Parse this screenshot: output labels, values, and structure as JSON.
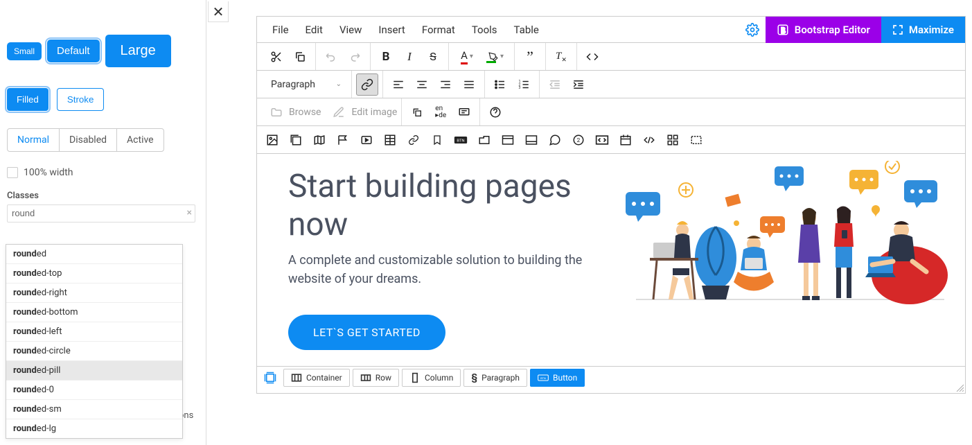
{
  "sidebar": {
    "sizes": {
      "small": "Small",
      "default": "Default",
      "large": "Large"
    },
    "fill": {
      "filled": "Filled",
      "stroke": "Stroke"
    },
    "states": {
      "normal": "Normal",
      "disabled": "Disabled",
      "active": "Active"
    },
    "fullwidth_label": "100% width",
    "classes_label": "Classes",
    "class_search_value": "round",
    "suggestions": [
      {
        "bold": "round",
        "rest": "ed"
      },
      {
        "bold": "round",
        "rest": "ed-top"
      },
      {
        "bold": "round",
        "rest": "ed-right"
      },
      {
        "bold": "round",
        "rest": "ed-bottom"
      },
      {
        "bold": "round",
        "rest": "ed-left"
      },
      {
        "bold": "round",
        "rest": "ed-circle"
      },
      {
        "bold": "round",
        "rest": "ed-pill"
      },
      {
        "bold": "round",
        "rest": "ed-0"
      },
      {
        "bold": "round",
        "rest": "ed-sm"
      },
      {
        "bold": "round",
        "rest": "ed-lg"
      }
    ],
    "truncated_text": "ons"
  },
  "menubar": {
    "items": [
      "File",
      "Edit",
      "View",
      "Insert",
      "Format",
      "Tools",
      "Table"
    ],
    "bootstrap_editor": "Bootstrap Editor",
    "maximize": "Maximize"
  },
  "toolbar2": {
    "paragraph_label": "Paragraph",
    "browse_label": "Browse",
    "edit_image_label": "Edit image"
  },
  "canvas": {
    "headline": "Start building pages now",
    "subtext": "A complete and customizable solution to building the website of your dreams.",
    "cta": "LET`S GET STARTED"
  },
  "breadcrumb": {
    "items": [
      "Container",
      "Row",
      "Column",
      "Paragraph",
      "Button"
    ]
  }
}
